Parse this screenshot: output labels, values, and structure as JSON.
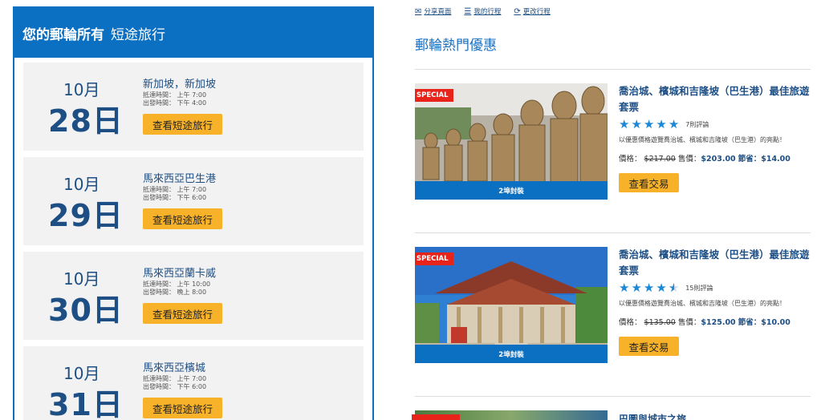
{
  "left": {
    "header_bold": "您的郵輪所有",
    "header_light": "短途旅行",
    "days": [
      {
        "month": "10月",
        "day": "28日",
        "port": "新加坡，新加坡",
        "arrive": "抵達時間： 上午 7:00",
        "depart": "出發時間： 下午 4:00",
        "button": "查看短途旅行"
      },
      {
        "month": "10月",
        "day": "29日",
        "port": "馬來西亞巴生港",
        "arrive": "抵達時間： 上午 7:00",
        "depart": "出發時間： 下午 6:00",
        "button": "查看短途旅行"
      },
      {
        "month": "10月",
        "day": "30日",
        "port": "馬來西亞蘭卡威",
        "arrive": "抵達時間： 上午 10:00",
        "depart": "出發時間： 晚上 8:00",
        "button": "查看短途旅行"
      },
      {
        "month": "10月",
        "day": "31日",
        "port": "馬來西亞檳城",
        "arrive": "抵達時間： 上午 7:00",
        "depart": "出發時間： 下午 6:00",
        "button": "查看短途旅行"
      }
    ]
  },
  "top_links": [
    {
      "icon": "envelope-icon",
      "label": "分享頁面"
    },
    {
      "icon": "list-icon",
      "label": "我的行程"
    },
    {
      "icon": "refresh-icon",
      "label": "更改行程"
    }
  ],
  "section_title": "郵輪熱門優惠",
  "deals": [
    {
      "badge": "SPECIAL",
      "caption": "2埠封裝",
      "title": "喬治城、檳城和吉隆坡（巴生港）最佳旅遊套票",
      "rating": 5,
      "reviews": "7則評論",
      "desc": "以優惠價格遊覽喬治城、檳城和吉隆坡（巴生港）的亮點！",
      "price_label": "價格：",
      "old_price": "$217.00",
      "sale_label": "售價：",
      "sale_price": "$203.00",
      "save_label": "節省：",
      "save_price": "$14.00",
      "button": "查看交易"
    },
    {
      "badge": "SPECIAL",
      "caption": "2埠封裝",
      "title": "喬治城、檳城和吉隆坡（巴生港）最佳旅遊套票",
      "rating": 4.5,
      "reviews": "15則評論",
      "desc": "以優惠價格遊覽喬治城、檳城和吉隆坡（巴生港）的亮點！",
      "price_label": "價格：",
      "old_price": "$135.00",
      "sale_label": "售價：",
      "sale_price": "$125.00",
      "save_label": "節省：",
      "save_price": "$10.00",
      "button": "查看交易"
    }
  ],
  "deal3_title": "巴圖與城市之旅",
  "colors": {
    "primary": "#0b6fc2",
    "accent": "#f8b22a",
    "special": "#e8231a",
    "navy": "#1d4e84"
  }
}
